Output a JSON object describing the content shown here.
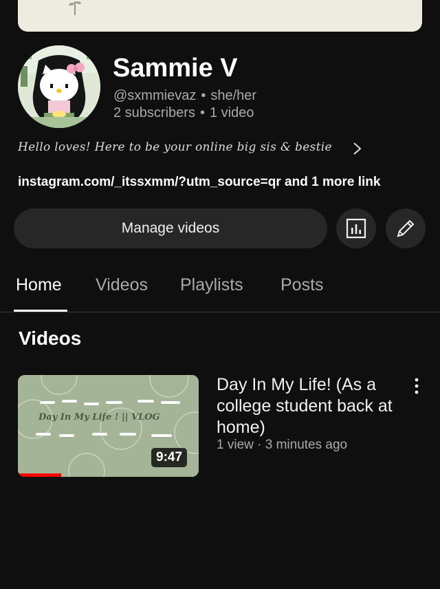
{
  "channel": {
    "name": "Sammie V",
    "handle": "@sxmmievaz",
    "pronouns": "she/her",
    "subscribers": "2 subscribers",
    "video_count": "1 video",
    "separator": "•",
    "bio": "Hello loves! Here to be your online big sis & bestie",
    "link": "instagram.com/_itssxmm/?utm_source=qr and 1 more link"
  },
  "actions": {
    "manage_videos": "Manage videos",
    "analytics_icon": "analytics-icon",
    "edit_icon": "pencil-icon"
  },
  "tabs": [
    {
      "label": "Home",
      "active": true
    },
    {
      "label": "Videos",
      "active": false
    },
    {
      "label": "Playlists",
      "active": false
    },
    {
      "label": "Posts",
      "active": false
    }
  ],
  "videos_section": {
    "title": "Videos",
    "items": [
      {
        "title": "Day In My Life! (As a college student back at home)",
        "views": "1 view",
        "age": "3 minutes ago",
        "meta_separator": "·",
        "duration": "9:47",
        "thumbnail_text": "Day In My Life ! || VLOG",
        "watch_progress": 0.24
      }
    ]
  },
  "colors": {
    "background": "#0f0f0f",
    "button": "#272727",
    "secondary_text": "#aaaaaa",
    "progress_red": "#ff0000",
    "thumbnail_green": "#a3b596"
  }
}
